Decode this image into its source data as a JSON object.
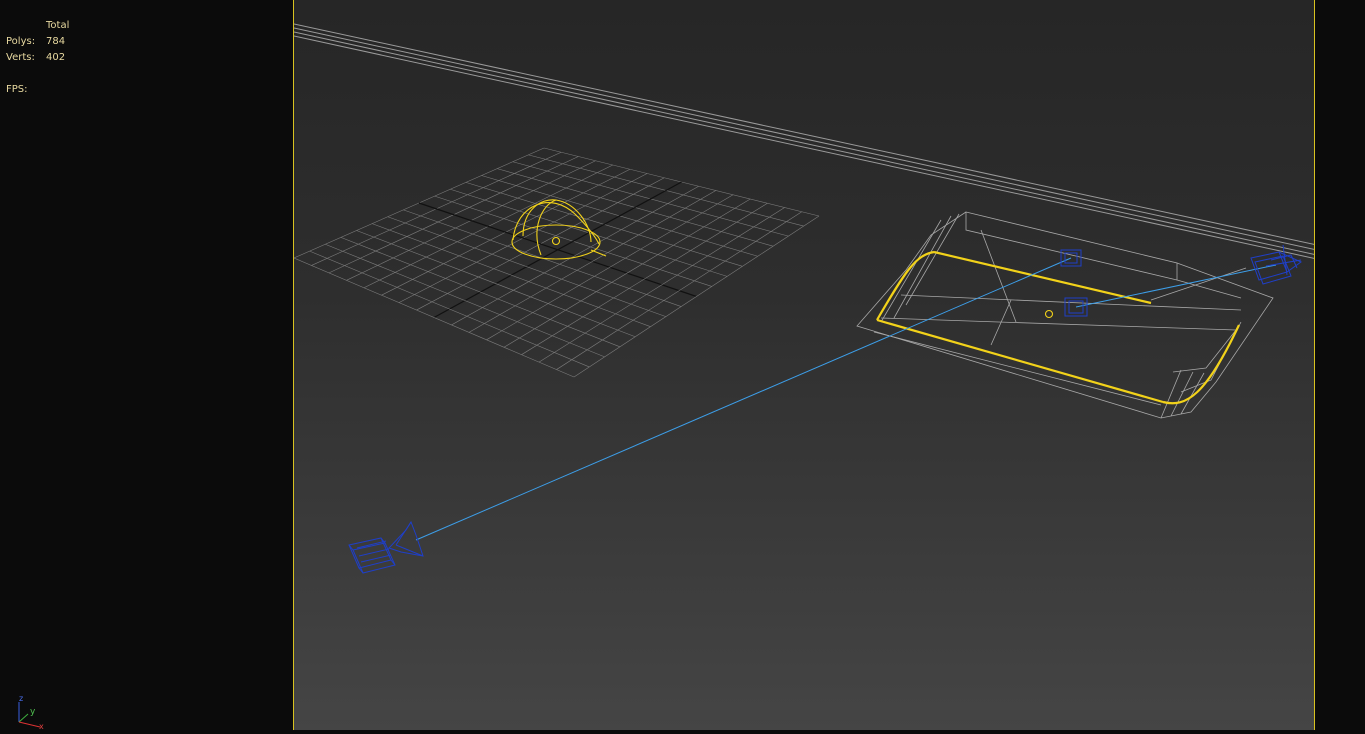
{
  "stats": {
    "total_label": "Total",
    "polys_label": "Polys:",
    "polys_value": "784",
    "verts_label": "Verts:",
    "verts_value": "402",
    "fps_label": "FPS:",
    "fps_value": ""
  },
  "axis": {
    "z": "z",
    "y": "y",
    "x": "x"
  },
  "colors": {
    "selection": "#f2d21a",
    "wire": "#8d8d8d",
    "grid": "#7a7a7a",
    "camera": "#1f3fc8",
    "target_line": "#3d9ee8",
    "viewport_border": "#d8c220"
  }
}
